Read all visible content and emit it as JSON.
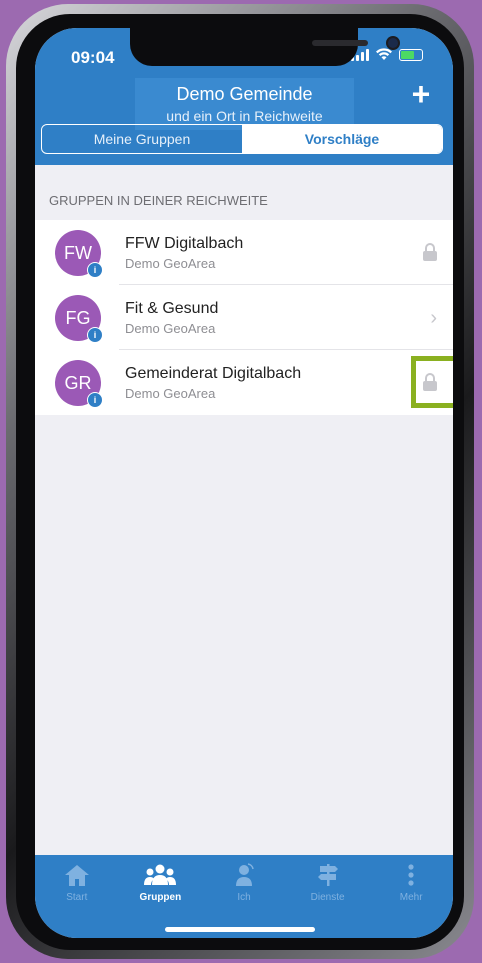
{
  "status_bar": {
    "time": "09:04"
  },
  "header": {
    "title": "Demo Gemeinde",
    "subtitle": "und ein Ort in Reichweite",
    "add_label": "+"
  },
  "segments": [
    {
      "label": "Meine Gruppen",
      "active": false
    },
    {
      "label": "Vorschläge",
      "active": true
    }
  ],
  "section": {
    "title": "GRUPPEN IN DEINER REICHWEITE"
  },
  "groups": [
    {
      "initials": "FW",
      "name": "FFW Digitalbach",
      "area": "Demo GeoArea",
      "accessory": "lock-icon"
    },
    {
      "initials": "FG",
      "name": "Fit & Gesund",
      "area": "Demo GeoArea",
      "accessory": "chevron-right-icon"
    },
    {
      "initials": "GR",
      "name": "Gemeinderat Digitalbach",
      "area": "Demo GeoArea",
      "accessory": "lock-icon"
    }
  ],
  "tabs": [
    {
      "label": "Start",
      "icon": "home-icon",
      "active": false
    },
    {
      "label": "Gruppen",
      "icon": "groups-icon",
      "active": true
    },
    {
      "label": "Ich",
      "icon": "person-icon",
      "active": false
    },
    {
      "label": "Dienste",
      "icon": "signpost-icon",
      "active": false
    },
    {
      "label": "Mehr",
      "icon": "more-icon",
      "active": false
    }
  ],
  "colors": {
    "brand": "#2f7fc6",
    "avatar": "#9b59b6",
    "highlight": "#8ab020",
    "background": "#9c6ab0"
  }
}
